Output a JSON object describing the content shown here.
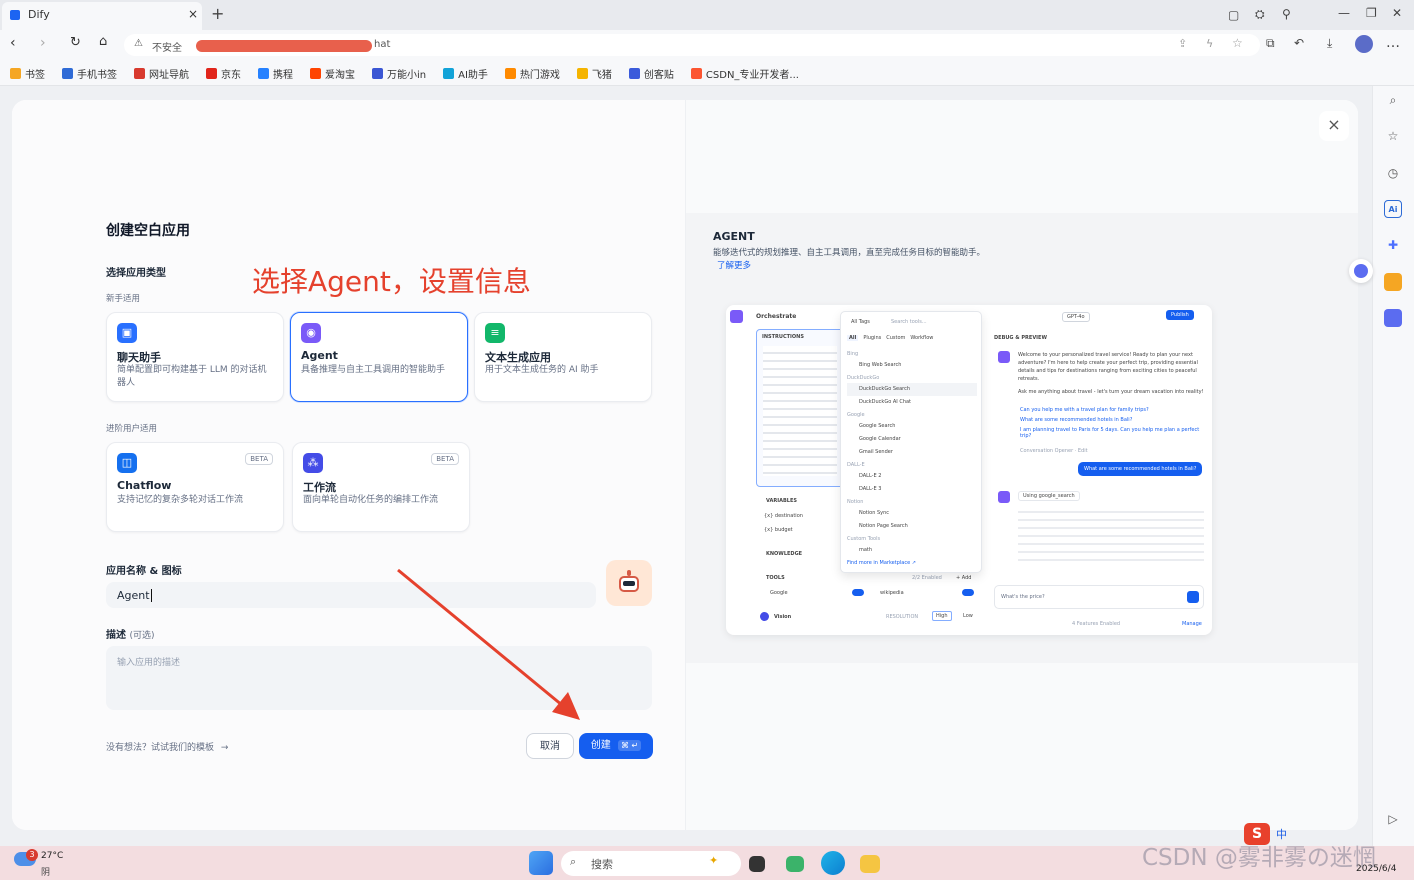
{
  "browser": {
    "tab_title": "Dify",
    "tab_close": "×",
    "new_tab": "+",
    "security": "不安全",
    "address_suffix": "hat",
    "menu": "…"
  },
  "bookmarks": [
    {
      "label": "书签",
      "color": "#f5a623"
    },
    {
      "label": "手机书签",
      "color": "#2f6bd6"
    },
    {
      "label": "网址导航",
      "color": "#d83a2e"
    },
    {
      "label": "京东",
      "color": "#e1251b"
    },
    {
      "label": "携程",
      "color": "#2681ff"
    },
    {
      "label": "爱淘宝",
      "color": "#ff4400"
    },
    {
      "label": "万能小in",
      "color": "#3a56d4"
    },
    {
      "label": "AI助手",
      "color": "#12a3d8"
    },
    {
      "label": "热门游戏",
      "color": "#ff8a00"
    },
    {
      "label": "飞猪",
      "color": "#f5b400"
    },
    {
      "label": "创客贴",
      "color": "#3b5bdb"
    },
    {
      "label": "CSDN_专业开发者...",
      "color": "#fc5531"
    }
  ],
  "modal": {
    "title": "创建空白应用",
    "type_label": "选择应用类型",
    "beginner_label": "新手适用",
    "advanced_label": "进阶用户适用",
    "cards_beginner": [
      {
        "title": "聊天助手",
        "desc": "简单配置即可构建基于 LLM 的对话机器人",
        "icon_color": "#2970ff",
        "icon": "chat-bubble-icon"
      },
      {
        "title": "Agent",
        "desc": "具备推理与自主工具调用的智能助手",
        "icon_color": "#7a5af8",
        "icon": "agent-icon"
      },
      {
        "title": "文本生成应用",
        "desc": "用于文本生成任务的 AI 助手",
        "icon_color": "#12b76a",
        "icon": "text-gen-icon"
      }
    ],
    "cards_advanced": [
      {
        "title": "Chatflow",
        "desc": "支持记忆的复杂多轮对话工作流",
        "icon_color": "#1570ef",
        "icon": "chatflow-icon",
        "badge": "BETA"
      },
      {
        "title": "工作流",
        "desc": "面向单轮自动化任务的编排工作流",
        "icon_color": "#444ce7",
        "icon": "workflow-icon",
        "badge": "BETA"
      }
    ],
    "name_label": "应用名称 & 图标",
    "name_value": "Agent",
    "desc_label": "描述",
    "desc_optional": "(可选)",
    "desc_placeholder": "输入应用的描述",
    "template_hint": "没有想法？试试我们的模板",
    "template_arrow": "→",
    "cancel": "取消",
    "create": "创建",
    "create_shortcut": "⌘ ↵",
    "close": "×"
  },
  "annotation": "选择Agent，设置信息",
  "preview": {
    "heading": "AGENT",
    "description": "能够迭代式的规划推理、自主工具调用，直至完成任务目标的智能助手。",
    "learn_more": "了解更多",
    "mock": {
      "orchestrate": "Orchestrate",
      "instructions": "INSTRUCTIONS",
      "variables": "VARIABLES",
      "var1": "{x} destination",
      "var2": "{x} budget",
      "knowledge": "KNOWLEDGE",
      "tools": "TOOLS",
      "tools_count": "2/2 Enabled",
      "tools_add": "+ Add",
      "tool1": "Google",
      "tool2": "wikipedia",
      "vision": "Vision",
      "resolution": "RESOLUTION",
      "high": "High",
      "low": "Low",
      "all_tags": "All Tags",
      "search_tools": "Search tools...",
      "filters": [
        "All",
        "Plugins",
        "Custom",
        "Workflow"
      ],
      "groups": [
        {
          "name": "Bing",
          "items": [
            "Bing Web Search"
          ]
        },
        {
          "name": "DuckDuckGo",
          "items": [
            "DuckDuckGo Search",
            "DuckDuckGo AI Chat"
          ]
        },
        {
          "name": "Google",
          "items": [
            "Google Search",
            "Google Calendar",
            "Gmail Sender"
          ]
        },
        {
          "name": "DALL-E",
          "items": [
            "DALL-E 2",
            "DALL-E 3"
          ]
        },
        {
          "name": "Notion",
          "items": [
            "Notion Sync",
            "Notion Page Search"
          ]
        },
        {
          "name": "Custom Tools",
          "items": [
            "math"
          ]
        }
      ],
      "marketplace": "Find more in Marketplace ↗",
      "model": "GPT-4o",
      "publish": "Publish",
      "debug": "DEBUG & PREVIEW",
      "welcome": "Welcome to your personalized travel service! Ready to plan your next adventure? I'm here to help create your perfect trip, providing essential details and tips for destinations ranging from exciting cities to peaceful retreats.",
      "ask": "Ask me anything about travel - let's turn your dream vacation into reality!",
      "suggestions": [
        "Can you help me with a travel plan for family trips?",
        "What are some recommended hotels in Bali?",
        "I am planning travel to Paris for 5 days. Can you help me plan a perfect trip?"
      ],
      "opener": "Conversation Opener · Edit",
      "user_msg": "What are some recommended hotels in Bali?",
      "using": "Using",
      "using_tool": "google_search",
      "input_placeholder": "What's the price?",
      "features": "4 Features Enabled",
      "manage": "Manage"
    }
  },
  "sidebar_icons": [
    "search-icon",
    "star-icon",
    "history-icon",
    "ai-icon",
    "game-icon",
    "translate-icon",
    "bag-icon",
    "note-icon"
  ],
  "taskbar": {
    "weather_temp": "27°C",
    "weather_desc": "阴",
    "weather_badge": "3",
    "search": "搜索",
    "date": "2025/6/4",
    "ime_label": "中"
  },
  "watermark": "CSDN @雾非雾の迷惘"
}
